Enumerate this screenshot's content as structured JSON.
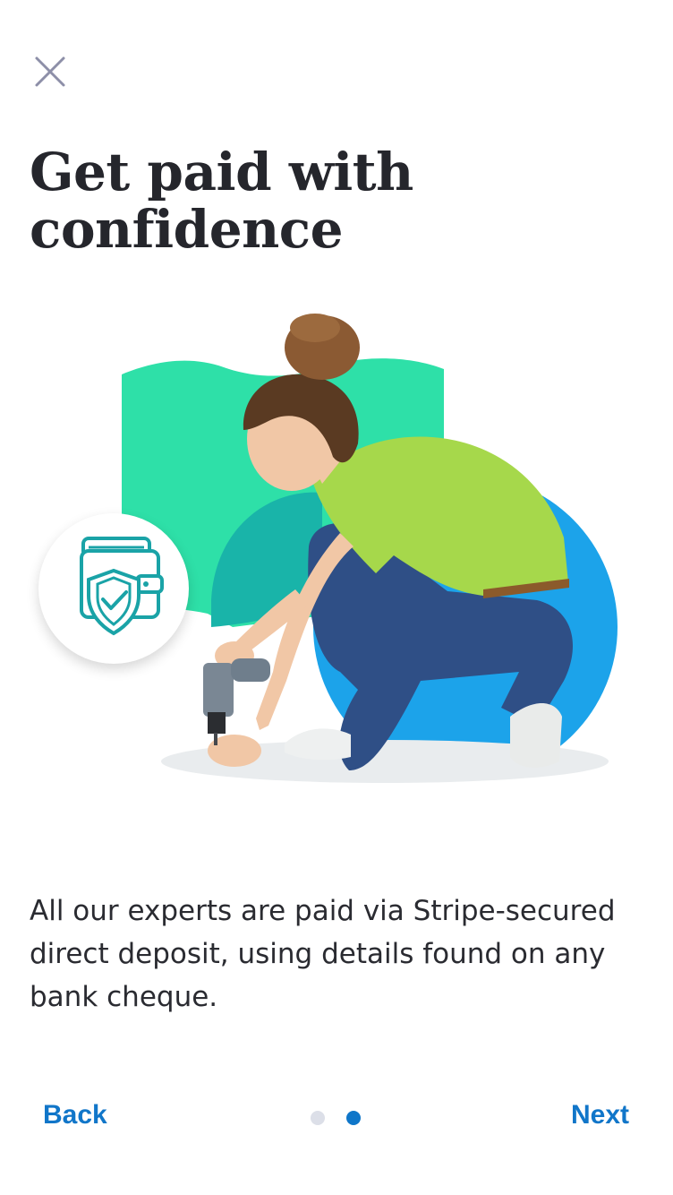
{
  "header": {
    "close_icon": "close-icon",
    "title": "Get paid with confidence"
  },
  "illustration": {
    "subject": "woman-with-drill-photo",
    "badge_icon": "wallet-shield-check-icon",
    "colors": {
      "green_shape": "#2ee0a8",
      "blue_circle": "#1ca3ea",
      "badge_icon": "#1aa3a7"
    }
  },
  "body": {
    "description": "All our experts are paid via Stripe-secured direct deposit, using details found on any bank cheque."
  },
  "footer": {
    "back_label": "Back",
    "next_label": "Next",
    "pagination": {
      "total": 2,
      "current": 2
    },
    "accent_color": "#1176c9"
  }
}
